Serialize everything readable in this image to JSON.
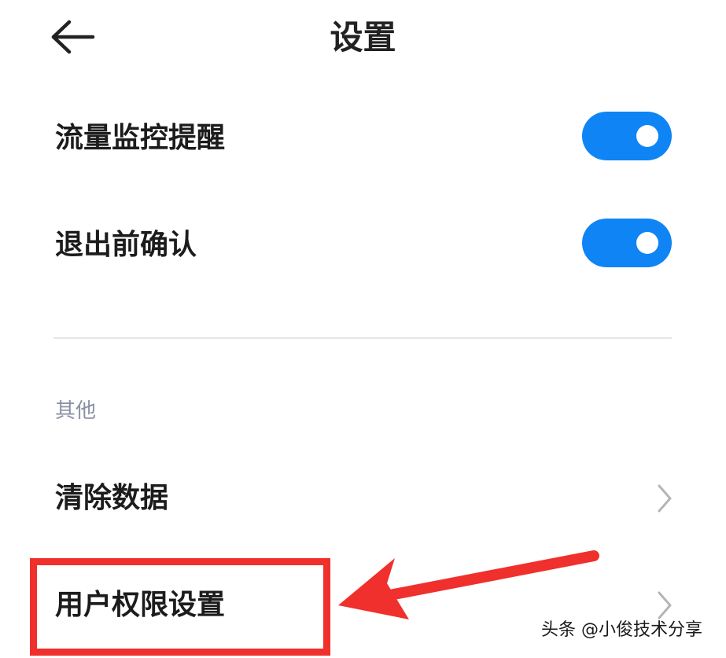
{
  "header": {
    "title": "设置",
    "back_icon": "arrow-left-icon"
  },
  "settings": {
    "traffic_monitor": {
      "label": "流量监控提醒",
      "enabled": true
    },
    "exit_confirm": {
      "label": "退出前确认",
      "enabled": true
    }
  },
  "other_section": {
    "title": "其他",
    "items": [
      {
        "label": "清除数据",
        "icon": "chevron-right-icon"
      },
      {
        "label": "用户权限设置",
        "icon": "chevron-right-icon"
      }
    ]
  },
  "annotation": {
    "box_color": "#f0302c",
    "arrow_color": "#f0302c"
  },
  "watermark": "头条 @小俊技术分享",
  "colors": {
    "toggle_on": "#0f84f5",
    "section_header": "#8a8fa3"
  }
}
